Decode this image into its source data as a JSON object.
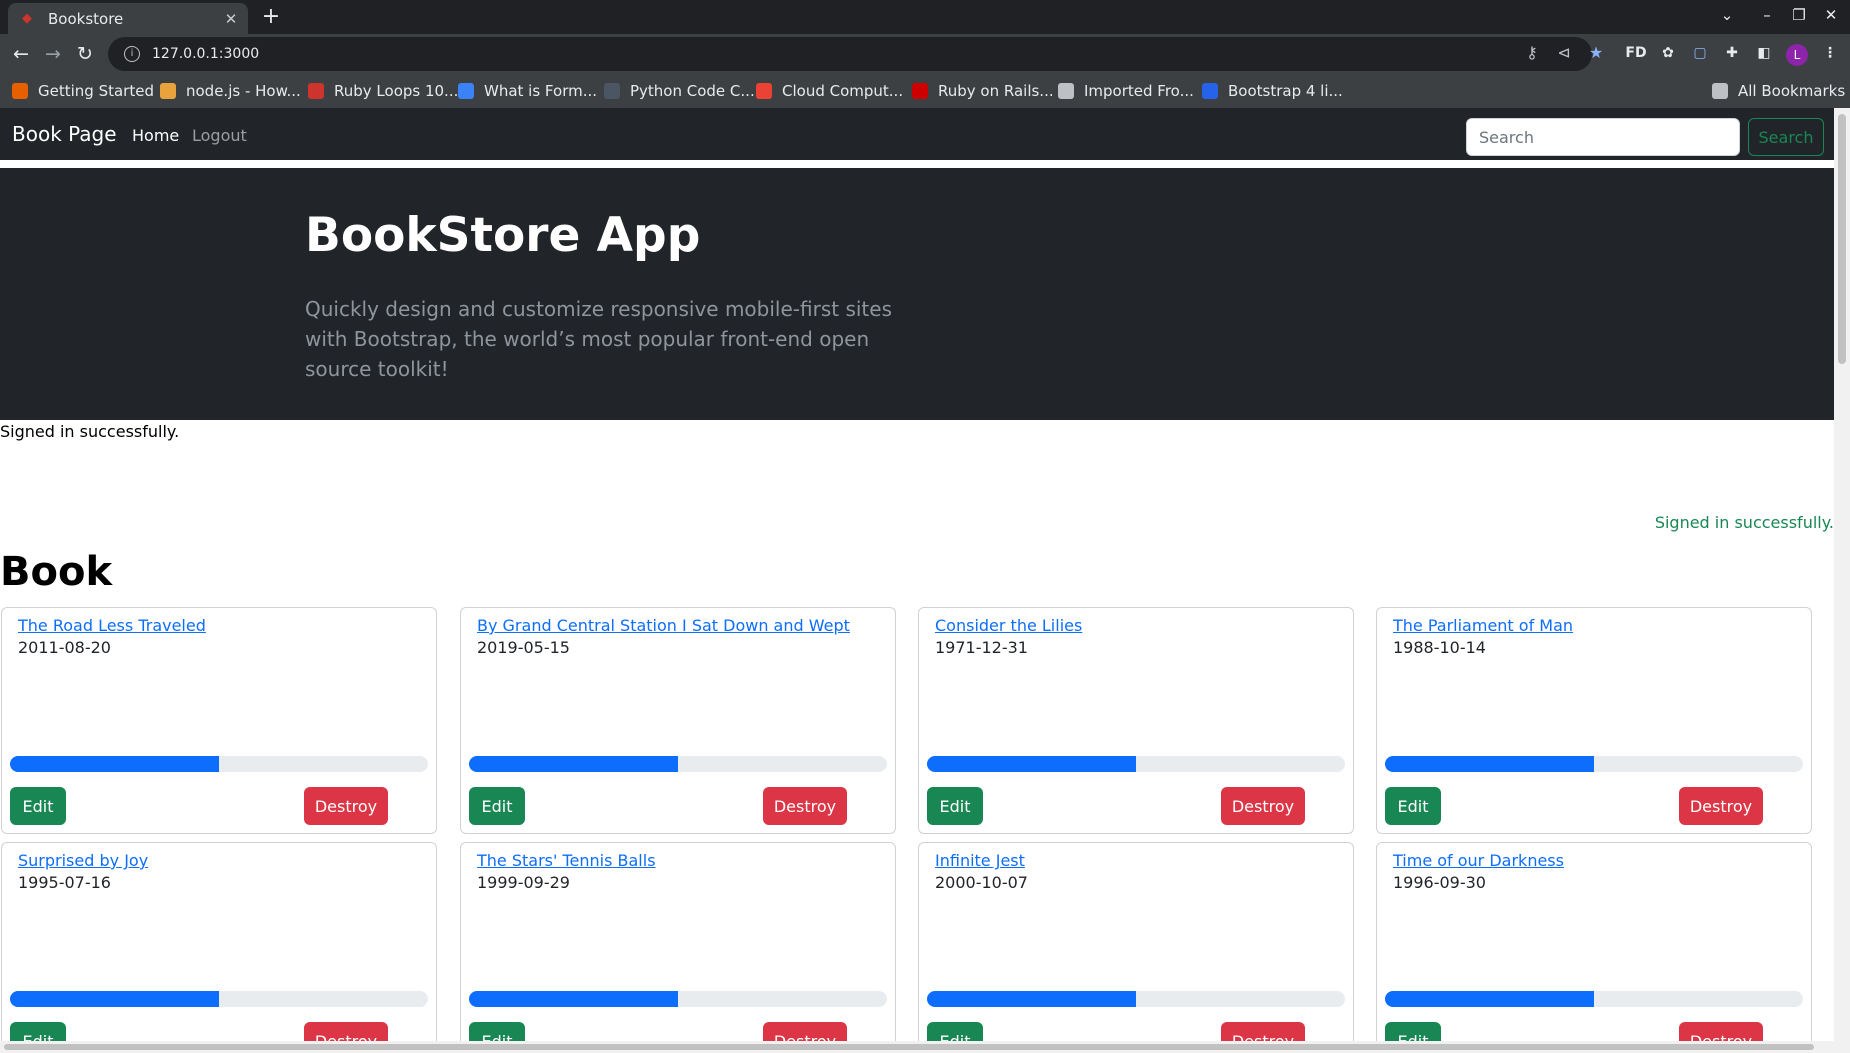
{
  "browser": {
    "tab_title": "Bookstore",
    "url": "127.0.0.1:3000",
    "profile_initial": "L",
    "bookmarks": [
      {
        "label": "Getting Started",
        "icon": "firefox-icon",
        "color": "#e66000"
      },
      {
        "label": "node.js - How...",
        "icon": "site-icon",
        "color": "#e8a33d"
      },
      {
        "label": "Ruby Loops 10...",
        "icon": "ruby-icon",
        "color": "#cc342d"
      },
      {
        "label": "What is Form...",
        "icon": "shield-icon",
        "color": "#3b82f6"
      },
      {
        "label": "Python Code C...",
        "icon": "python-icon",
        "color": "#4b5563"
      },
      {
        "label": "Cloud Comput...",
        "icon": "cloud-icon",
        "color": "#ea4335"
      },
      {
        "label": "Ruby on Rails...",
        "icon": "rails-icon",
        "color": "#cc0000"
      },
      {
        "label": "Imported Fro...",
        "icon": "folder-icon",
        "color": "#bdc1c6"
      },
      {
        "label": "Bootstrap 4 li...",
        "icon": "bootstrap-icon",
        "color": "#2563eb"
      }
    ],
    "all_bookmarks_label": "All Bookmarks"
  },
  "navbar": {
    "brand": "Book Page",
    "home": "Home",
    "logout": "Logout",
    "search_placeholder": "Search",
    "search_button": "Search"
  },
  "hero": {
    "title": "BookStore App",
    "lead": "Quickly design and customize responsive mobile-first sites with Bootstrap, the world’s most popular front-end open source toolkit!"
  },
  "notice": "Signed in successfully.",
  "notice_right": "Signed in successfully.",
  "page_heading": "Book",
  "edit_label": "Edit",
  "destroy_label": "Destroy",
  "books": [
    {
      "title": "The Road Less Traveled",
      "date": "2011-08-20",
      "progress": 0.5
    },
    {
      "title": "By Grand Central Station I Sat Down and Wept",
      "date": "2019-05-15",
      "progress": 0.5
    },
    {
      "title": "Consider the Lilies",
      "date": "1971-12-31",
      "progress": 0.5
    },
    {
      "title": "The Parliament of Man",
      "date": "1988-10-14",
      "progress": 0.5
    },
    {
      "title": "Surprised by Joy",
      "date": "1995-07-16",
      "progress": 0.5
    },
    {
      "title": "The Stars' Tennis Balls",
      "date": "1999-09-29",
      "progress": 0.5
    },
    {
      "title": "Infinite Jest",
      "date": "2000-10-07",
      "progress": 0.5
    },
    {
      "title": "Time of our Darkness",
      "date": "1996-09-30",
      "progress": 0.5
    }
  ]
}
